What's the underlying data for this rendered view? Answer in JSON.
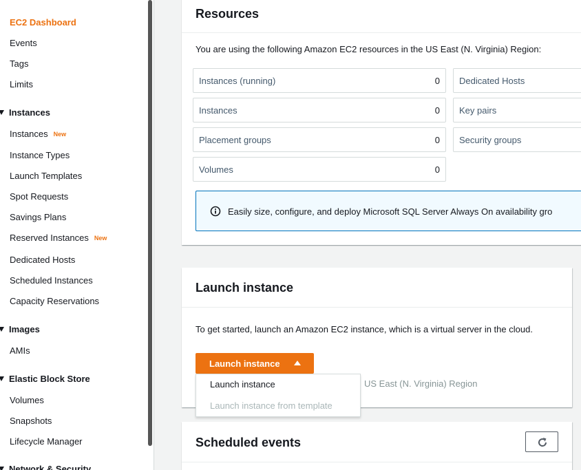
{
  "sidebar": {
    "top_cut": "...",
    "ec2_dashboard": "EC2 Dashboard",
    "events": "Events",
    "tags": "Tags",
    "limits": "Limits",
    "sections": {
      "instances": "Instances",
      "images": "Images",
      "ebs": "Elastic Block Store",
      "network": "Network & Security"
    },
    "instances_items": [
      "Instances",
      "Instance Types",
      "Launch Templates",
      "Spot Requests",
      "Savings Plans",
      "Reserved Instances",
      "Dedicated Hosts",
      "Scheduled Instances",
      "Capacity Reservations"
    ],
    "new_badge": "New",
    "images_items": [
      "AMIs"
    ],
    "ebs_items": [
      "Volumes",
      "Snapshots",
      "Lifecycle Manager"
    ]
  },
  "resources": {
    "title": "Resources",
    "intro": "You are using the following Amazon EC2 resources in the US East (N. Virginia) Region:",
    "items": [
      {
        "label": "Instances (running)",
        "count": "0"
      },
      {
        "label": "Instances",
        "count": "0"
      },
      {
        "label": "Placement groups",
        "count": "0"
      },
      {
        "label": "Volumes",
        "count": "0"
      },
      {
        "label": "Dedicated Hosts",
        "count": ""
      },
      {
        "label": "Key pairs",
        "count": ""
      },
      {
        "label": "Security groups",
        "count": ""
      }
    ],
    "info_text": "Easily size, configure, and deploy Microsoft SQL Server Always On availability gro"
  },
  "launch": {
    "title": "Launch instance",
    "description": "To get started, launch an Amazon EC2 instance, which is a virtual server in the cloud.",
    "button_label": "Launch instance",
    "region_note": "US East (N. Virginia) Region",
    "dropdown": {
      "item1": "Launch instance",
      "item2": "Launch instance from template"
    }
  },
  "scheduled": {
    "title": "Scheduled events"
  },
  "colors": {
    "accent": "#ec7211",
    "link": "#44596c",
    "info_border": "#0073bb"
  }
}
